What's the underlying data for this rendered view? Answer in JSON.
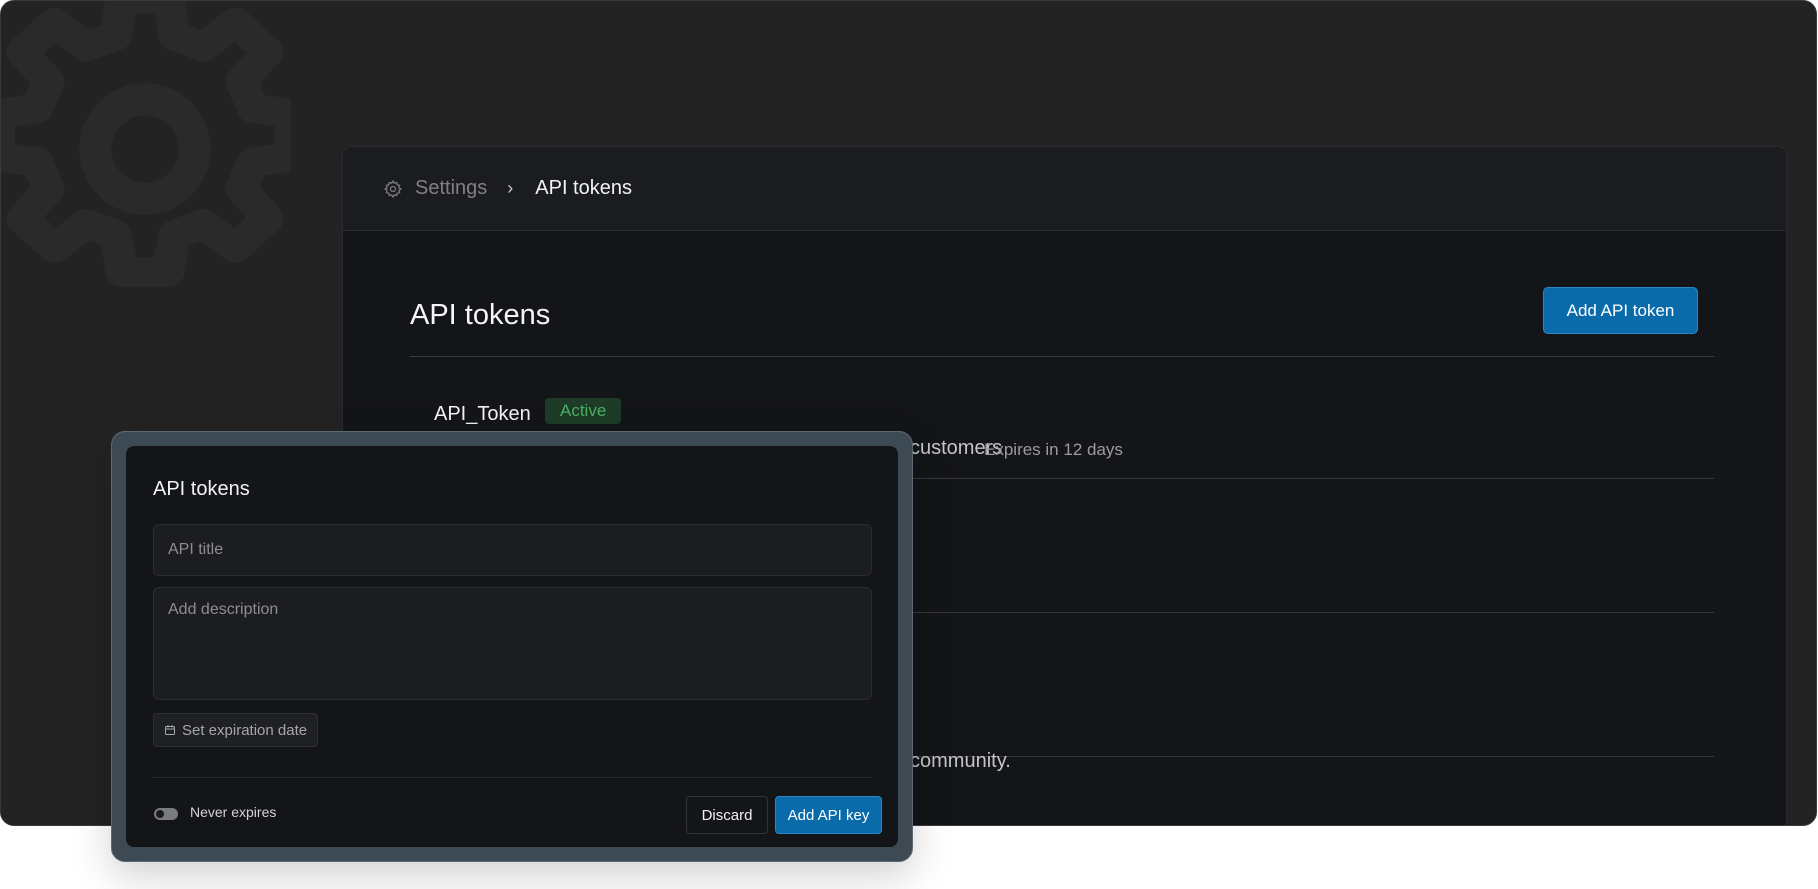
{
  "breadcrumb": {
    "icon": "gear-icon",
    "parent": "Settings",
    "separator": "›",
    "current": "API tokens"
  },
  "page": {
    "title": "API tokens",
    "add_button": "Add API token"
  },
  "tokens": [
    {
      "name": "API_Token",
      "status": "Active",
      "status_color": "#4caf63",
      "description": "customers",
      "expires": "Expires in 12 days"
    },
    {
      "description": "community."
    }
  ],
  "modal": {
    "title": "API tokens",
    "title_placeholder": "API title",
    "description_placeholder": "Add description",
    "expiration_button": "Set expiration date",
    "expiration_icon": "calendar-icon",
    "never_expires_label": "Never expires",
    "discard_button": "Discard",
    "submit_button": "Add API key"
  },
  "colors": {
    "accent": "#0a6bab",
    "background": "#232323",
    "panel": "#141518",
    "active_badge_bg": "#1d3b26"
  }
}
